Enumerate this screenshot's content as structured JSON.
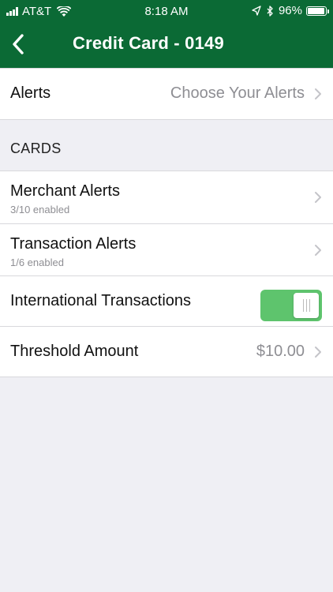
{
  "status_bar": {
    "carrier": "AT&T",
    "time": "8:18 AM",
    "battery_percent": "96%",
    "battery_level": 0.96
  },
  "nav": {
    "title": "Credit Card - 0149",
    "back_icon": "chevron-left-icon"
  },
  "alerts_row": {
    "label": "Alerts",
    "value": "Choose Your Alerts"
  },
  "cards_section": {
    "header": "CARDS",
    "rows": [
      {
        "label": "Merchant Alerts",
        "sub": "3/10 enabled"
      },
      {
        "label": "Transaction Alerts",
        "sub": "1/6 enabled"
      },
      {
        "label": "International Transactions",
        "toggle_on": true
      },
      {
        "label": "Threshold Amount",
        "value": "$10.00"
      }
    ]
  },
  "colors": {
    "header_bg": "#0b6a35",
    "toggle_on": "#5ec46d",
    "background": "#efeff4"
  }
}
